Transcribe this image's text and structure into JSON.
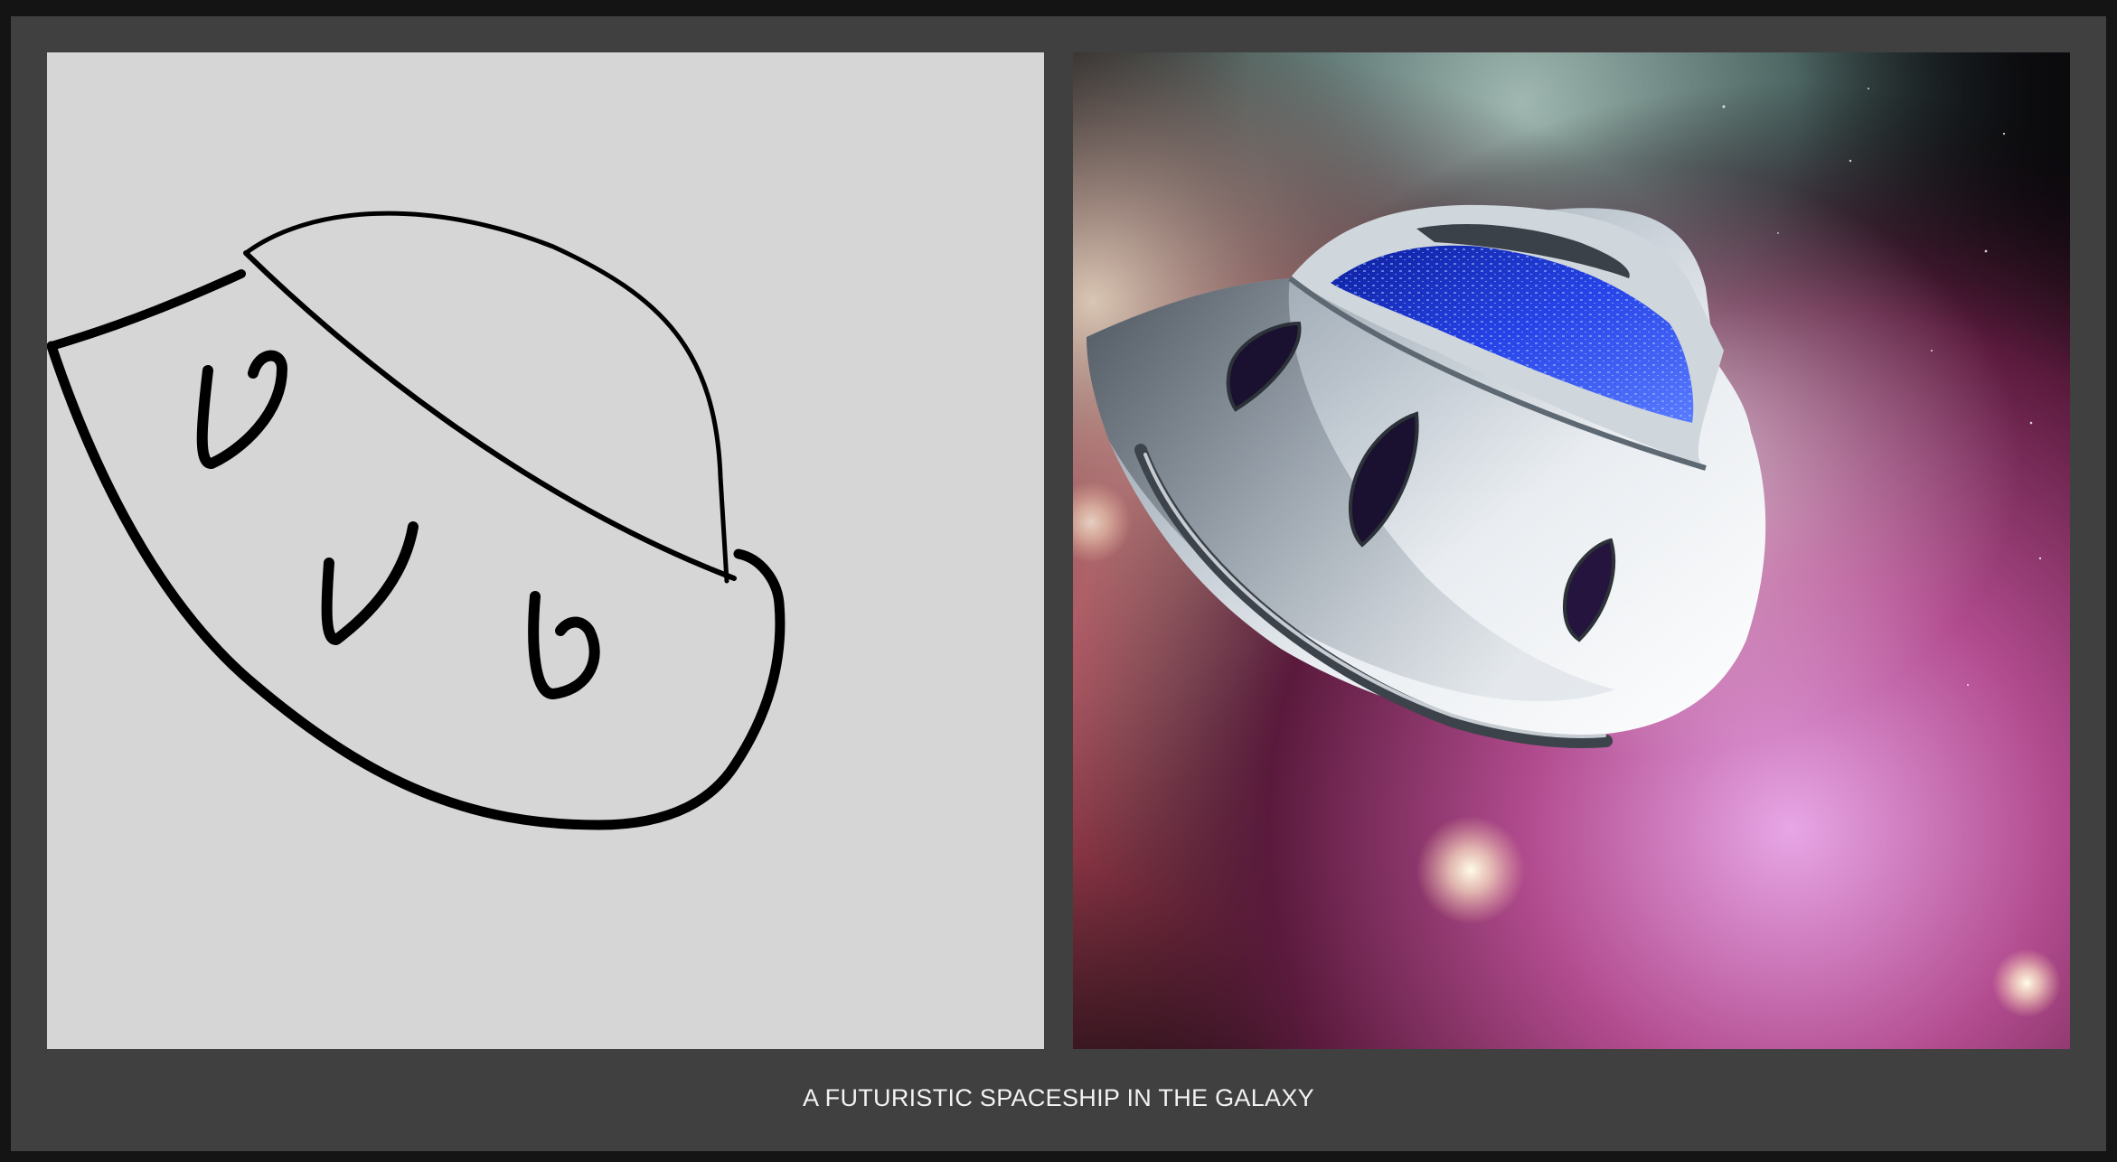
{
  "caption": "A FUTURISTIC SPACESHIP IN THE GALAXY",
  "colors": {
    "page_bg": "#141414",
    "frame_bg": "#404040",
    "sketch_bg": "#d6d6d6",
    "caption_text": "#f2f2f2"
  },
  "panels": [
    {
      "name": "sketch-panel",
      "content": "hand-drawn-spaceship-sketch"
    },
    {
      "name": "generated-image-panel",
      "content": "rendered-spaceship-in-galaxy"
    }
  ]
}
